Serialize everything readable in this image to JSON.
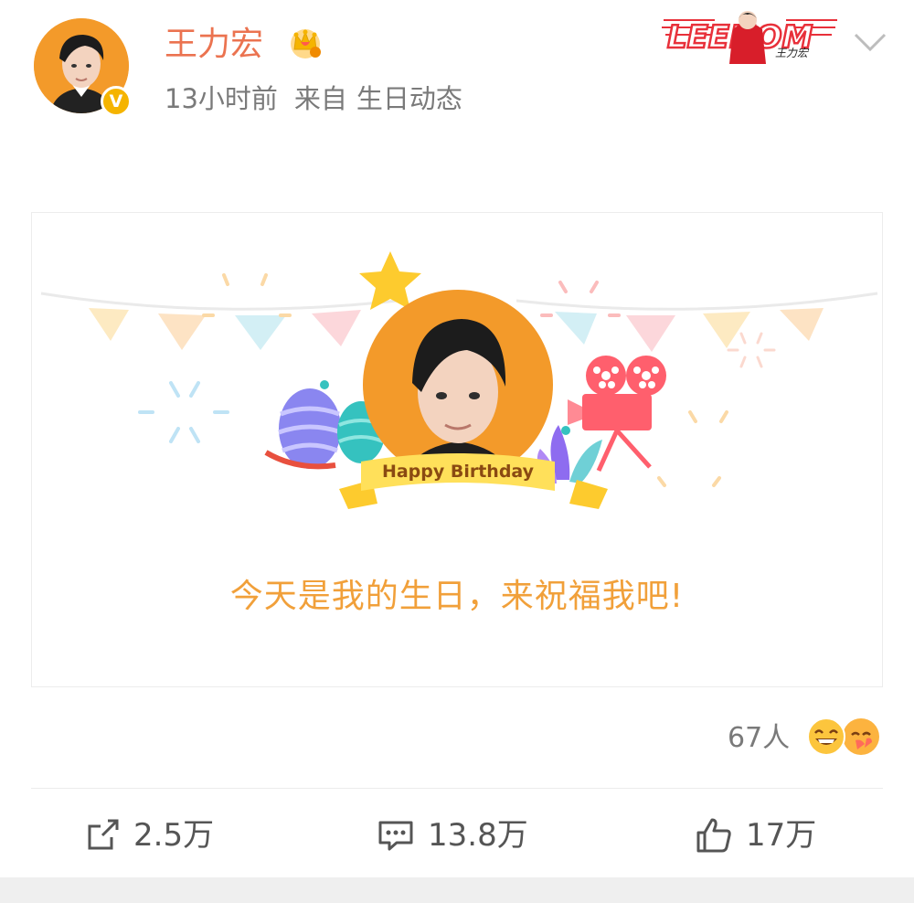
{
  "post": {
    "author": "王力宏",
    "time": "13小时前",
    "source_prefix": "来自",
    "source": "生日动态",
    "brand_badge_text": "LEEHOM",
    "badge_sub": "王力宏",
    "avatar_badge": "V",
    "crown_icon": "crown-icon",
    "more_icon": "chevron-down-icon"
  },
  "card": {
    "banner_text": "Happy Birthday",
    "message": "今天是我的生日，来祝福我吧!"
  },
  "reactions": {
    "count_label": "67人",
    "emojis": [
      "grinning-face-icon",
      "heart-hug-icon"
    ]
  },
  "actions": {
    "repost": "2.5万",
    "comments": "13.8万",
    "likes": "17万"
  },
  "colors": {
    "username": "#eb7350",
    "accent_orange": "#f39a2a",
    "wish_text": "#f1a03a",
    "gray_text": "#7a7a7a"
  }
}
